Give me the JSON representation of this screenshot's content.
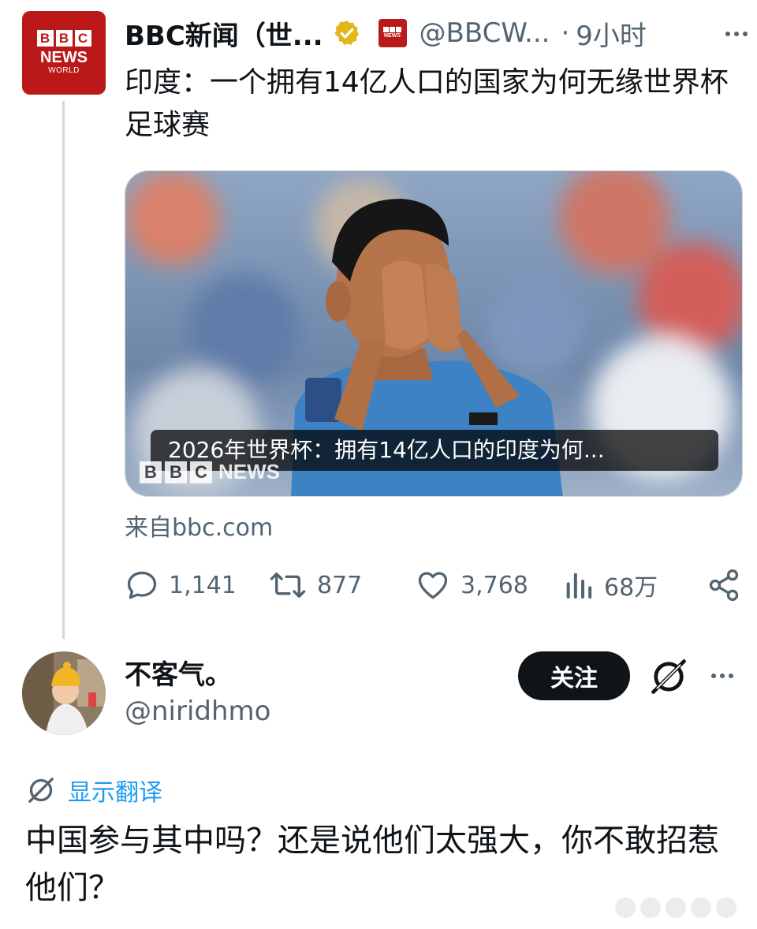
{
  "tweet": {
    "avatar": {
      "line1": [
        "B",
        "B",
        "C"
      ],
      "line2": "NEWS",
      "line3": "WORLD",
      "color": "#bb1919"
    },
    "author_name": "BBC新闻（世...",
    "handle": "@BBCW...",
    "separator": "·",
    "time": "9小时",
    "text": "印度：一个拥有14亿人口的国家为何无缘世界杯足球赛",
    "card": {
      "title": "2026年世界杯：拥有14亿人口的印度为何...",
      "watermark": {
        "blocks": [
          "B",
          "B",
          "C"
        ],
        "word": "NEWS"
      },
      "source": "来自bbc.com"
    },
    "actions": {
      "replies": "1,141",
      "retweets": "877",
      "likes": "3,768",
      "views": "68万"
    }
  },
  "reply": {
    "author_name": "不客气。",
    "handle": "@niridhmo",
    "follow_label": "关注",
    "translate_label": "显示翻译",
    "text": "中国参与其中吗？还是说他们太强大，你不敢招惹他们？"
  },
  "colors": {
    "text_primary": "#0f1419",
    "text_secondary": "#536471",
    "link_blue": "#1d9bf0",
    "bbc_red": "#bb1919",
    "verified_gold": "#e2b719"
  },
  "icons": [
    "bbc-logo-icon",
    "verified-gold-icon",
    "bbc-affiliate-icon",
    "more-icon",
    "reply-icon",
    "retweet-icon",
    "like-icon",
    "views-icon",
    "share-icon",
    "grok-icon",
    "translate-icon"
  ]
}
